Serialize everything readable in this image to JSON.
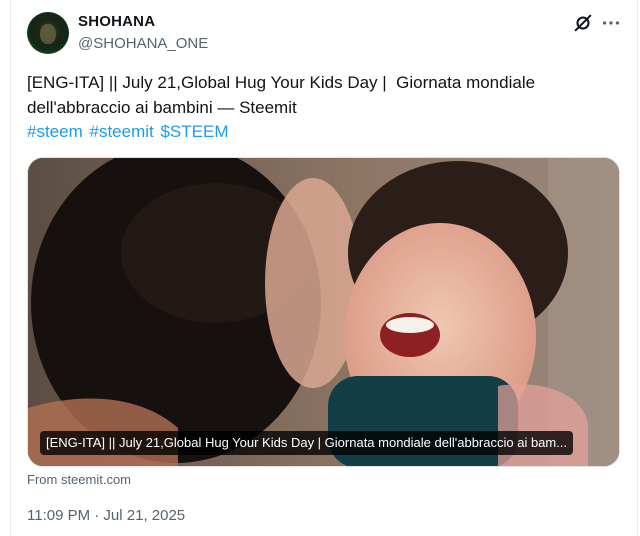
{
  "author": {
    "display_name": "SHOHANA",
    "handle": "@SHOHANA_ONE"
  },
  "header_icons": {
    "grok": "grok-icon",
    "more": "more-icon"
  },
  "tweet": {
    "text": "[ENG-ITA] || July 21,Global Hug Your Kids Day |  Giornata mondiale dell'abbraccio ai bambini — Steemit",
    "hashtags": [
      "#steem",
      "#steemit",
      "$STEEM"
    ]
  },
  "card": {
    "caption": "[ENG-ITA] || July 21,Global Hug Your Kids Day | Giornata mondiale dell'abbraccio ai bam...",
    "source": "From steemit.com"
  },
  "timestamp": "11:09 PM · Jul 21, 2025",
  "colors": {
    "link": "#1d9bf0",
    "secondary_text": "#536471",
    "primary_text": "#0f1419"
  }
}
